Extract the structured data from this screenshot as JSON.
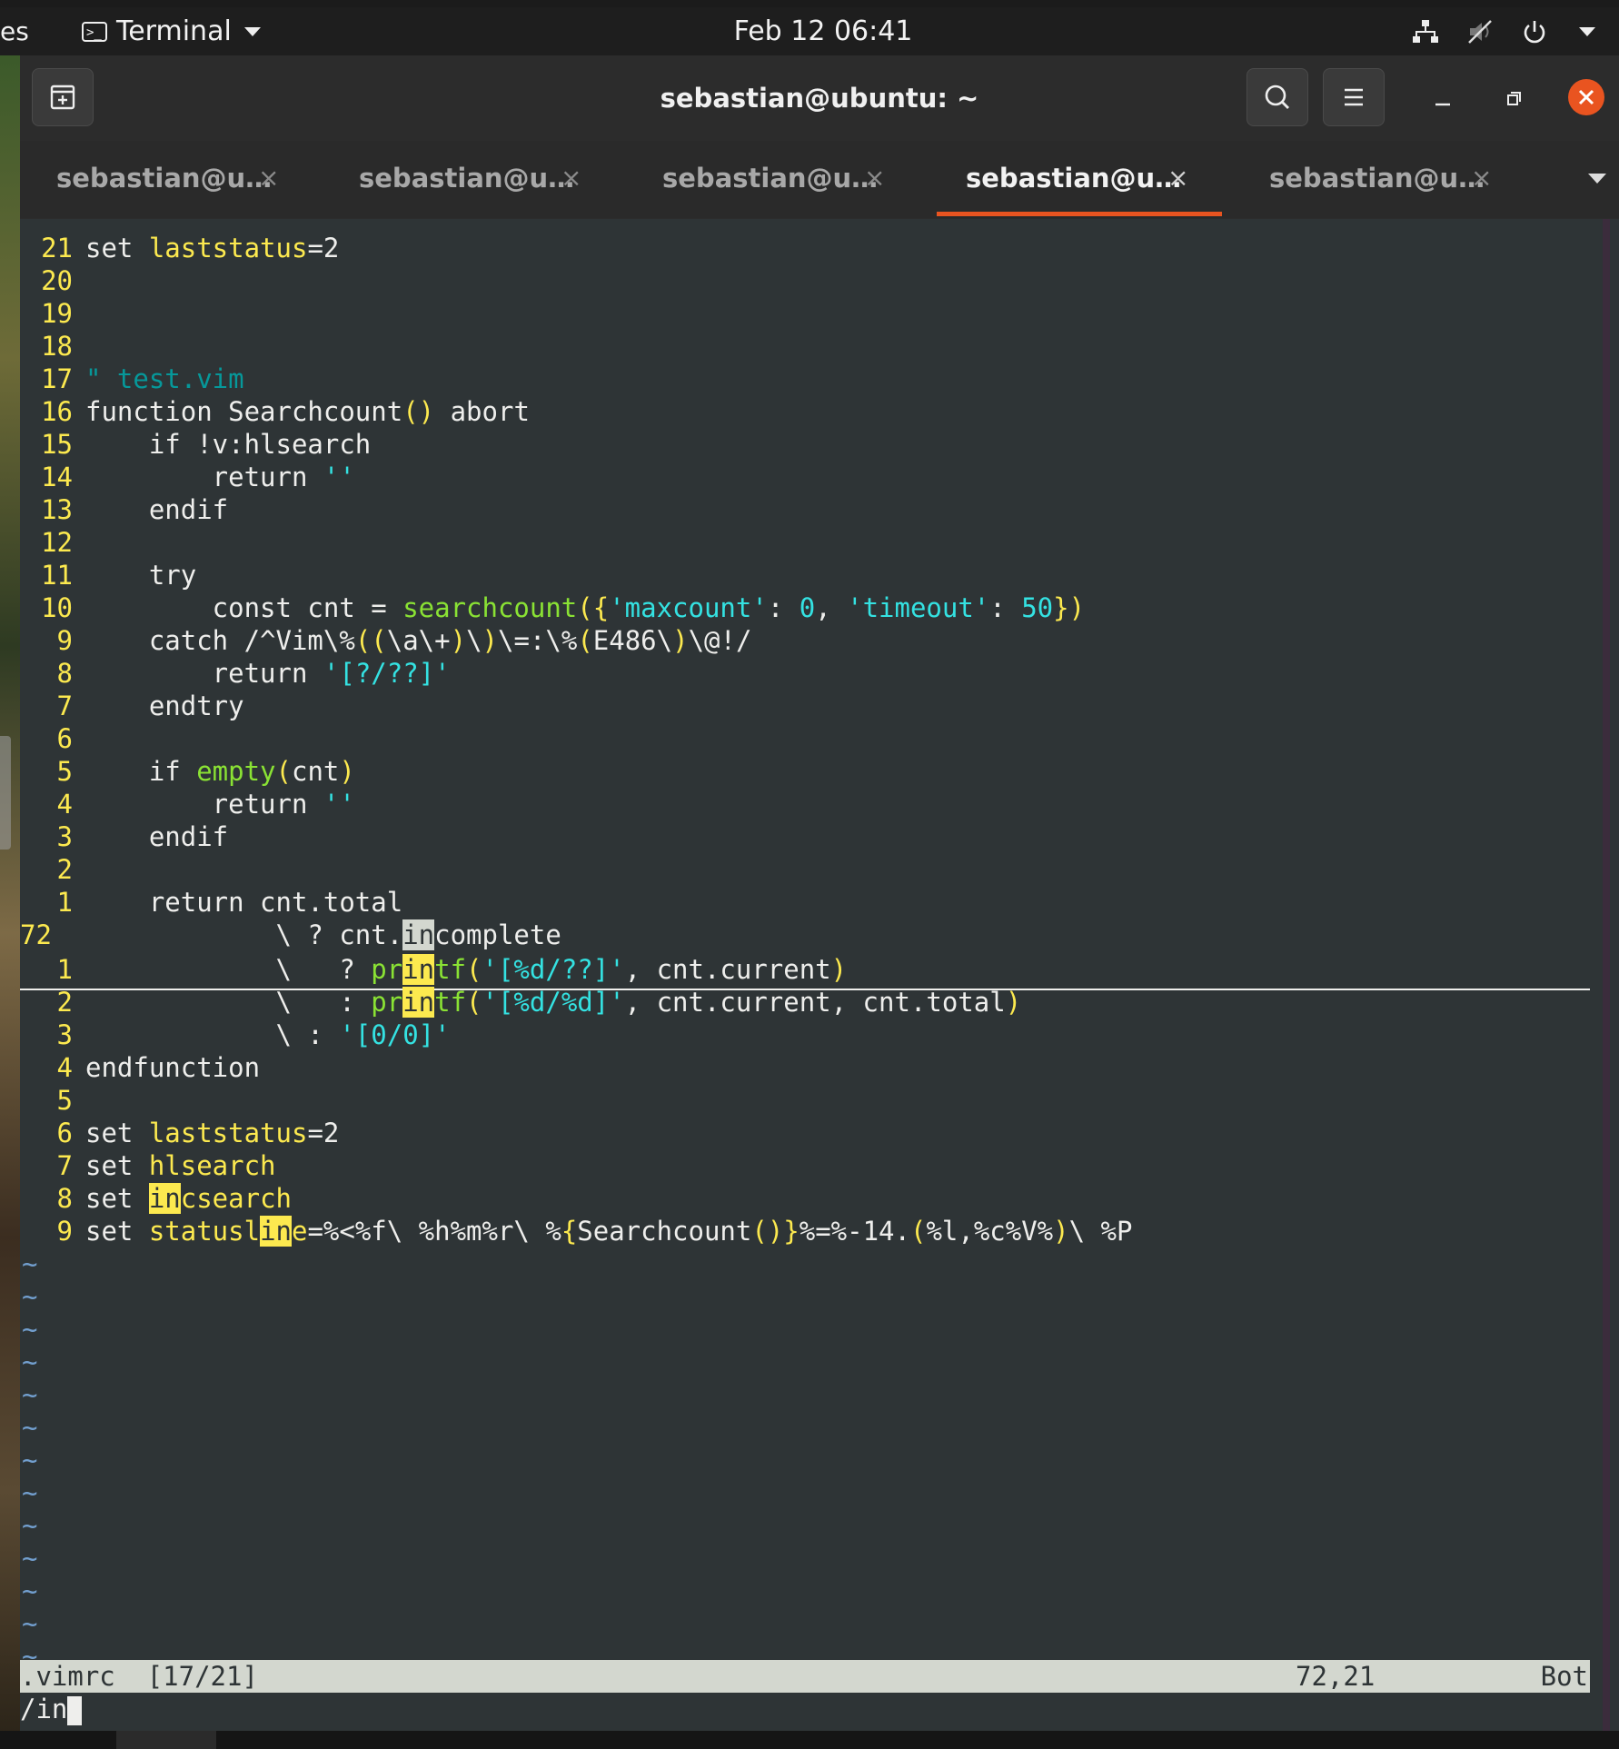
{
  "topbar": {
    "activities_partial": "es",
    "app_menu_label": "Terminal",
    "clock": "Feb 12  06:41"
  },
  "window": {
    "title": "sebastian@ubuntu: ~"
  },
  "tabs": [
    {
      "label": "sebastian@u…",
      "active": false
    },
    {
      "label": "sebastian@u…",
      "active": false
    },
    {
      "label": "sebastian@u…",
      "active": false
    },
    {
      "label": "sebastian@u…",
      "active": true
    },
    {
      "label": "sebastian@u…",
      "active": false
    }
  ],
  "tab_close_glyph": "×",
  "vim": {
    "top_lines": [
      {
        "n": "21",
        "text": "set laststatus=2"
      },
      {
        "n": "20",
        "text": ""
      },
      {
        "n": "19",
        "text": ""
      },
      {
        "n": "18",
        "text": ""
      },
      {
        "n": "17",
        "text": "\" test.vim"
      },
      {
        "n": "16",
        "text": "function Searchcount() abort"
      },
      {
        "n": "15",
        "text": "    if !v:hlsearch"
      },
      {
        "n": "14",
        "text": "        return ''"
      },
      {
        "n": "13",
        "text": "    endif"
      },
      {
        "n": "12",
        "text": ""
      },
      {
        "n": "11",
        "text": "    try"
      },
      {
        "n": "10",
        "text": "        const cnt = searchcount({'maxcount': 0, 'timeout': 50})"
      },
      {
        "n": "9",
        "text": "    catch /^Vim\\%((\\a\\+)\\)\\=:\\%(E486\\)\\@!/"
      },
      {
        "n": "8",
        "text": "        return '[?/??]'"
      },
      {
        "n": "7",
        "text": "    endtry"
      },
      {
        "n": "6",
        "text": ""
      },
      {
        "n": "5",
        "text": "    if empty(cnt)"
      },
      {
        "n": "4",
        "text": "        return ''"
      },
      {
        "n": "3",
        "text": "    endif"
      },
      {
        "n": "2",
        "text": ""
      },
      {
        "n": "1",
        "text": "    return cnt.total"
      },
      {
        "n": "72",
        "text": "            \\ ? cnt.incomplete"
      }
    ],
    "bottom_lines": [
      {
        "n": "1",
        "text": "            \\   ? printf('[%d/??]', cnt.current)"
      },
      {
        "n": "2",
        "text": "            \\   : printf('[%d/%d]', cnt.current, cnt.total)"
      },
      {
        "n": "3",
        "text": "            \\ : '[0/0]'"
      },
      {
        "n": "4",
        "text": "endfunction"
      },
      {
        "n": "5",
        "text": ""
      },
      {
        "n": "6",
        "text": "set laststatus=2"
      },
      {
        "n": "7",
        "text": "set hlsearch"
      },
      {
        "n": "8",
        "text": "set incsearch"
      },
      {
        "n": "9",
        "text": "set statusline=%<%f\\ %h%m%r\\ %{Searchcount()}%=%-14.(%l,%c%V%)\\ %P"
      }
    ],
    "tilde": "~",
    "tilde_count": 13,
    "status": {
      "file": ".vimrc",
      "count": "[17/21]",
      "position": "72,21",
      "percent": "Bot"
    },
    "command_line": "/in"
  }
}
